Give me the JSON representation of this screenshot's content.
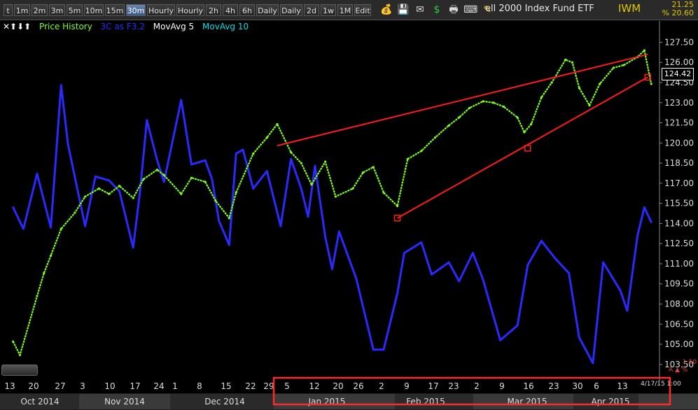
{
  "toolbar": {
    "buttons": [
      "t",
      "1m",
      "2m",
      "3m",
      "5m",
      "10m",
      "15m",
      "30m",
      "Hourly",
      "Hourly",
      "2h",
      "4h",
      "6h",
      "Daily",
      "Daily",
      "2d",
      "1w",
      "1M",
      "Edit"
    ],
    "active_index": 7,
    "icons": [
      "money-bag-icon",
      "save-icon",
      "mail-icon",
      "dollar-icon",
      "print-icon",
      "keyboard-icon",
      "pencil-icon"
    ],
    "fund_name": "ell 2000 Index Fund ETF",
    "ticker": "IWM",
    "change_value": "21.25",
    "change_pct": "% 20.60"
  },
  "legend": {
    "arrows": "✕⬆⬇⬆",
    "price_history": "Price History",
    "three_c": "3C as F3.2",
    "mavg5": "MovAvg 5",
    "mavg10": "MovAvg 10"
  },
  "footer": {
    "date_stamp": "4/17/15 1:00",
    "sub_value": "1.50",
    "sub_mark": "A ▲ %"
  },
  "colors": {
    "background": "#000000",
    "price": "#7cff1a",
    "three_c": "#2a2aff",
    "trendline": "#ff1a1a",
    "axis_text": "#dddddd",
    "highlight_box": "#ff2a2a"
  },
  "chart_data": {
    "type": "line",
    "title": "",
    "ylabel": "",
    "y_axis_ticks": [
      "127.50",
      "126.00",
      "124.50",
      "123.00",
      "121.50",
      "120.00",
      "118.50",
      "117.00",
      "115.50",
      "114.00",
      "112.50",
      "111.00",
      "109.50",
      "108.00",
      "106.50",
      "105.00",
      "103.50"
    ],
    "ylim": [
      102.5,
      128.2
    ],
    "current_price": "124.42",
    "x_tick_labels": [
      "13",
      "20",
      "27",
      "3",
      "10",
      "17",
      "24",
      "1",
      "8",
      "15",
      "22",
      "29",
      "5",
      "12",
      "20",
      "26",
      "2",
      "9",
      "17",
      "23",
      "2",
      "9",
      "16",
      "23",
      "30",
      "6",
      "13"
    ],
    "month_labels": [
      "Oct 2014",
      "Nov 2014",
      "Dec 2014",
      "Jan 2015",
      "Feb 2015",
      "Mar 2015",
      "Apr 2015"
    ],
    "series": [
      {
        "name": "Price History",
        "x": [
          "2014-10-13",
          "2014-10-15",
          "2014-10-20",
          "2014-10-22",
          "2014-10-24",
          "2014-10-27",
          "2014-10-31",
          "2014-11-03",
          "2014-11-07",
          "2014-11-10",
          "2014-11-13",
          "2014-11-17",
          "2014-11-20",
          "2014-11-24",
          "2014-11-26",
          "2014-12-01",
          "2014-12-04",
          "2014-12-08",
          "2014-12-11",
          "2014-12-15",
          "2014-12-17",
          "2014-12-22",
          "2014-12-26",
          "2014-12-29",
          "2015-01-02",
          "2015-01-05",
          "2015-01-08",
          "2015-01-12",
          "2015-01-15",
          "2015-01-20",
          "2015-01-23",
          "2015-01-26",
          "2015-01-29",
          "2015-02-02",
          "2015-02-05",
          "2015-02-09",
          "2015-02-13",
          "2015-02-17",
          "2015-02-20",
          "2015-02-23",
          "2015-02-27",
          "2015-03-02",
          "2015-03-05",
          "2015-03-09",
          "2015-03-11",
          "2015-03-13",
          "2015-03-16",
          "2015-03-19",
          "2015-03-23",
          "2015-03-25",
          "2015-03-27",
          "2015-03-30",
          "2015-04-02",
          "2015-04-06",
          "2015-04-09",
          "2015-04-13",
          "2015-04-15",
          "2015-04-17"
        ],
        "y": [
          105.2,
          104.2,
          108.6,
          110.3,
          111.6,
          113.6,
          114.8,
          116.0,
          116.6,
          116.2,
          116.8,
          115.9,
          117.3,
          118.0,
          117.6,
          116.2,
          117.4,
          117.1,
          115.7,
          114.4,
          116.3,
          119.2,
          120.4,
          121.4,
          119.3,
          118.5,
          116.9,
          118.6,
          116.0,
          116.6,
          117.8,
          118.2,
          116.3,
          115.3,
          118.8,
          119.4,
          120.4,
          121.3,
          121.9,
          122.6,
          123.1,
          123.0,
          122.7,
          121.9,
          120.8,
          121.4,
          123.4,
          124.5,
          126.2,
          126.0,
          124.1,
          122.8,
          124.4,
          125.6,
          125.8,
          126.4,
          126.9,
          124.4
        ]
      },
      {
        "name": "3C as F3.2",
        "x": [
          "2014-10-13",
          "2014-10-16",
          "2014-10-20",
          "2014-10-24",
          "2014-10-27",
          "2014-10-29",
          "2014-11-03",
          "2014-11-06",
          "2014-11-10",
          "2014-11-13",
          "2014-11-17",
          "2014-11-19",
          "2014-11-21",
          "2014-11-24",
          "2014-11-26",
          "2014-12-01",
          "2014-12-04",
          "2014-12-08",
          "2014-12-10",
          "2014-12-12",
          "2014-12-15",
          "2014-12-17",
          "2014-12-19",
          "2014-12-22",
          "2014-12-26",
          "2014-12-30",
          "2015-01-02",
          "2015-01-05",
          "2015-01-07",
          "2015-01-09",
          "2015-01-12",
          "2015-01-14",
          "2015-01-16",
          "2015-01-21",
          "2015-01-26",
          "2015-01-29",
          "2015-02-02",
          "2015-02-04",
          "2015-02-09",
          "2015-02-12",
          "2015-02-17",
          "2015-02-20",
          "2015-02-24",
          "2015-02-27",
          "2015-03-04",
          "2015-03-09",
          "2015-03-12",
          "2015-03-16",
          "2015-03-20",
          "2015-03-24",
          "2015-03-27",
          "2015-03-31",
          "2015-04-03",
          "2015-04-08",
          "2015-04-10",
          "2015-04-13",
          "2015-04-15",
          "2015-04-17"
        ],
        "y": [
          115.2,
          113.6,
          117.7,
          113.7,
          124.3,
          119.9,
          113.8,
          117.5,
          117.2,
          116.4,
          112.2,
          116.4,
          121.7,
          118.7,
          117.1,
          123.2,
          118.4,
          118.7,
          117.3,
          114.2,
          112.4,
          119.2,
          119.5,
          116.6,
          117.9,
          113.8,
          118.8,
          116.6,
          114.5,
          118.3,
          113.0,
          110.6,
          113.4,
          109.9,
          104.6,
          104.6,
          108.8,
          111.8,
          112.6,
          110.2,
          111.1,
          109.7,
          111.8,
          109.8,
          105.3,
          106.4,
          110.9,
          112.7,
          111.4,
          110.3,
          105.5,
          103.6,
          111.1,
          109.0,
          107.5,
          113.1,
          115.2,
          114.1
        ]
      }
    ],
    "trendlines": [
      {
        "x": [
          "2014-12-29",
          "2015-04-16"
        ],
        "y": [
          119.8,
          126.6
        ]
      },
      {
        "x": [
          "2015-02-02",
          "2015-04-16"
        ],
        "y": [
          114.4,
          124.9
        ]
      }
    ],
    "markers": [
      {
        "x": "2015-02-02",
        "y": 114.4
      },
      {
        "x": "2015-03-12",
        "y": 119.6
      },
      {
        "x": "2015-04-16",
        "y": 124.9
      }
    ],
    "grid": false,
    "legend_placement": "top-left"
  }
}
